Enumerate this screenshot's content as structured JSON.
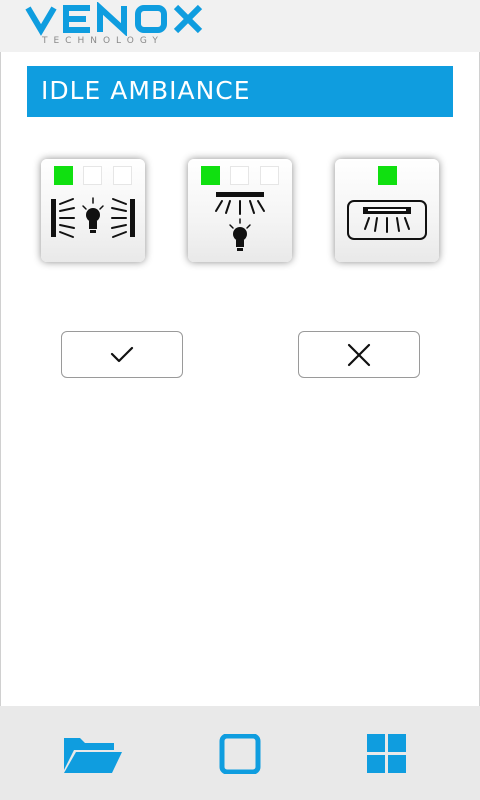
{
  "brand": {
    "name": "VENOX",
    "tagline": "TECHNOLOGY"
  },
  "title": "IDLE AMBIANCE",
  "colors": {
    "accent": "#0f9ddf",
    "indicator_on": "#10e010",
    "indicator_off": "#ffffff"
  },
  "modes": [
    {
      "icon": "side-lights-icon",
      "indicators": [
        "on",
        "off",
        "off"
      ]
    },
    {
      "icon": "ceiling-light-icon",
      "indicators": [
        "on",
        "off",
        "off"
      ]
    },
    {
      "icon": "floor-light-icon",
      "indicators": [
        "on"
      ]
    }
  ],
  "actions": {
    "confirm_icon": "check-icon",
    "cancel_icon": "close-icon"
  },
  "nav": {
    "items": [
      "folder-icon",
      "square-icon",
      "grid-icon"
    ]
  }
}
